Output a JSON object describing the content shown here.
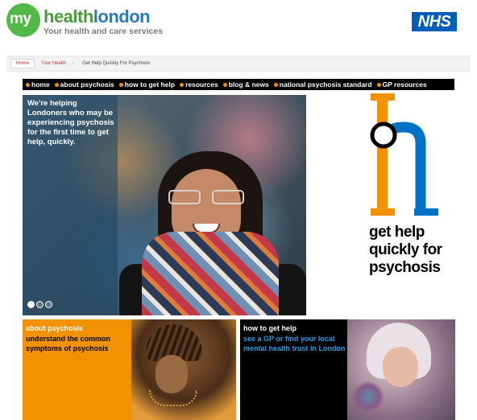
{
  "header": {
    "logo_my": "my",
    "logo_health": "health",
    "logo_london": "london",
    "logo_tagline": "Your health and care services",
    "nhs_logo": "NHS"
  },
  "breadcrumb": {
    "items": [
      "Home",
      "Your Health",
      "Get Help Quickly For Psychosis"
    ]
  },
  "nav": {
    "items": [
      "home",
      "about psychosis",
      "how to get help",
      "resources",
      "blog & news",
      "national psychosis standard",
      "GP resources"
    ]
  },
  "hero": {
    "text": "We're helping Londoners who may be experiencing psychosis for the first time to get help, quickly.",
    "slides": 3,
    "active_slide": 1
  },
  "side": {
    "tagline": "get help quickly for psychosis"
  },
  "cards": [
    {
      "title": "about psychosis",
      "body": "understand the common symptoms of psychosis"
    },
    {
      "title": "how to get help",
      "body": "see a GP or find your local mental health trust in London"
    }
  ],
  "colors": {
    "accent_orange": "#f39200",
    "nhs_blue": "#005eb8",
    "link_blue": "#2d9be0",
    "logo_green": "#52b848"
  }
}
